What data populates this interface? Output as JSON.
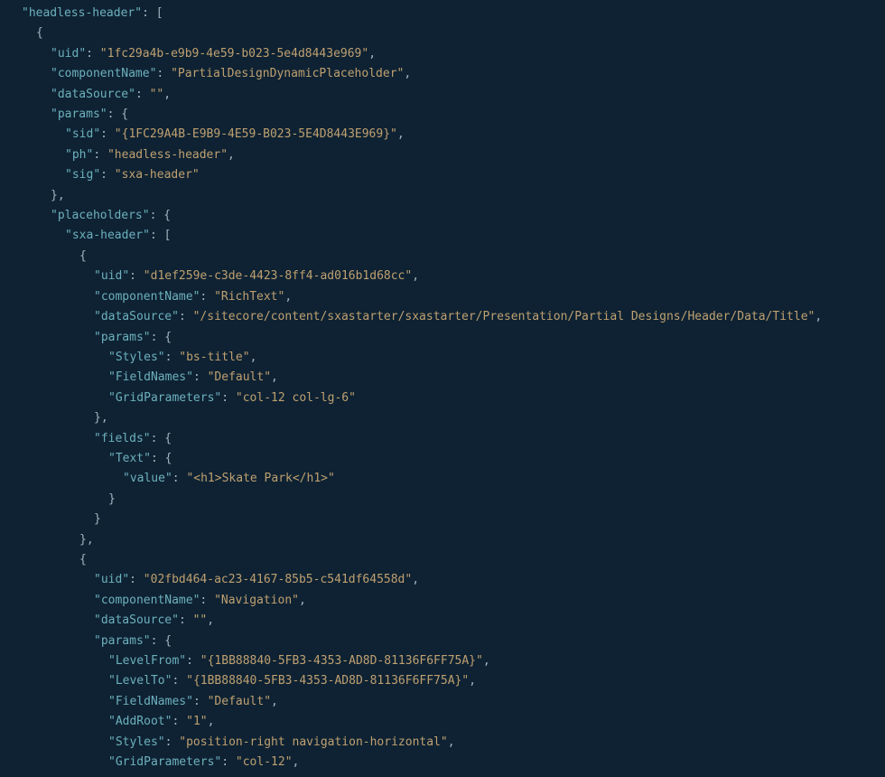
{
  "rootKey": "headless-header",
  "obj0": {
    "uid_key": "uid",
    "uid_val": "1fc29a4b-e9b9-4e59-b023-5e4d8443e969",
    "componentName_key": "componentName",
    "componentName_val": "PartialDesignDynamicPlaceholder",
    "dataSource_key": "dataSource",
    "dataSource_val": "",
    "params_key": "params",
    "sid_key": "sid",
    "sid_val": "{1FC29A4B-E9B9-4E59-B023-5E4D8443E969}",
    "ph_key": "ph",
    "ph_val": "headless-header",
    "sig_key": "sig",
    "sig_val": "sxa-header",
    "placeholders_key": "placeholders",
    "sxaheader_key": "sxa-header"
  },
  "obj1": {
    "uid_key": "uid",
    "uid_val": "d1ef259e-c3de-4423-8ff4-ad016b1d68cc",
    "componentName_key": "componentName",
    "componentName_val": "RichText",
    "dataSource_key": "dataSource",
    "dataSource_val": "/sitecore/content/sxastarter/sxastarter/Presentation/Partial Designs/Header/Data/Title",
    "params_key": "params",
    "Styles_key": "Styles",
    "Styles_val": "bs-title",
    "FieldNames_key": "FieldNames",
    "FieldNames_val": "Default",
    "GridParameters_key": "GridParameters",
    "GridParameters_val": "col-12 col-lg-6",
    "fields_key": "fields",
    "Text_key": "Text",
    "value_key": "value",
    "value_val": "<h1>Skate Park</h1>"
  },
  "obj2": {
    "uid_key": "uid",
    "uid_val": "02fbd464-ac23-4167-85b5-c541df64558d",
    "componentName_key": "componentName",
    "componentName_val": "Navigation",
    "dataSource_key": "dataSource",
    "dataSource_val": "",
    "params_key": "params",
    "LevelFrom_key": "LevelFrom",
    "LevelFrom_val": "{1BB88840-5FB3-4353-AD8D-81136F6FF75A}",
    "LevelTo_key": "LevelTo",
    "LevelTo_val": "{1BB88840-5FB3-4353-AD8D-81136F6FF75A}",
    "FieldNames_key": "FieldNames",
    "FieldNames_val": "Default",
    "AddRoot_key": "AddRoot",
    "AddRoot_val": "1",
    "Styles_key": "Styles",
    "Styles_val": "position-right navigation-horizontal",
    "GridParameters_key": "GridParameters",
    "GridParameters_val": "col-12"
  },
  "punct": {
    "colon_sp": ": ",
    "comma": ",",
    "lbrace": "{",
    "rbrace": "}",
    "lbrack": "[",
    "rbrack": "]",
    "rbrace_comma": "},",
    "q": "\""
  }
}
